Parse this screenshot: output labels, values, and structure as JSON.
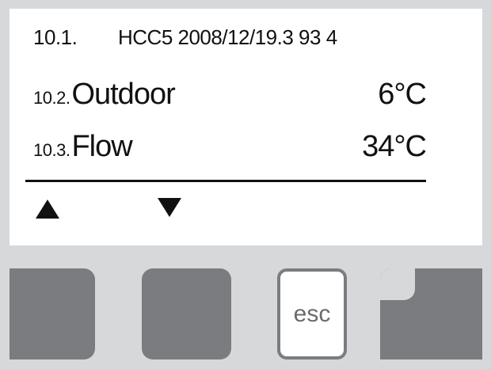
{
  "display": {
    "rows": [
      {
        "number": "10.1.",
        "text": "HCC5 2008/12/19.3 93 4"
      },
      {
        "number": "10.2.",
        "label": "Outdoor",
        "value": "6°C"
      },
      {
        "number": "10.3.",
        "label": "Flow",
        "value": "34°C"
      }
    ],
    "nav": {
      "up_icon": "triangle-up",
      "down_icon": "triangle-down"
    }
  },
  "buttons": {
    "esc_label": "esc"
  },
  "colors": {
    "frame": "#d7d8da",
    "screen": "#ffffff",
    "text": "#111111",
    "button": "#7b7c7f"
  }
}
